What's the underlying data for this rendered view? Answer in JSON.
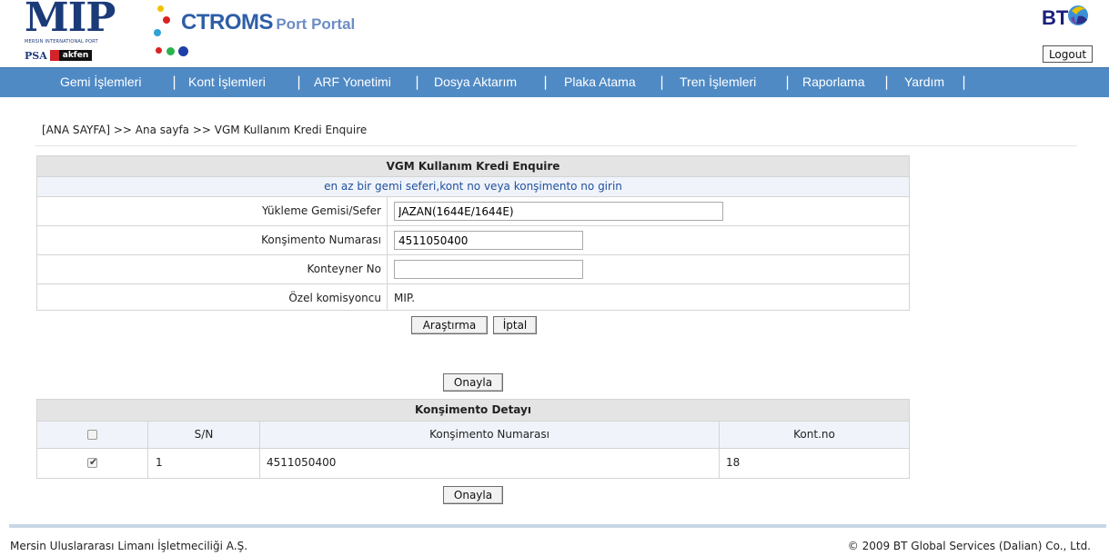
{
  "header": {
    "mip_logo": "MIP",
    "mip_subtitle": "MERSIN INTERNATIONAL PORT",
    "psa_text": "PSA",
    "akfen_text": "akfen",
    "portal_title_big": "CTROMS",
    "portal_title_small": "Port Portal",
    "bt_logo": "BT",
    "logout_label": "Logout",
    "colors": {
      "nav_bar": "#4f8ac5",
      "brand_blue": "#2f5ea8"
    }
  },
  "nav": {
    "items": [
      "Gemi İşlemleri",
      "Kont İşlemleri",
      "ARF Yonetimi",
      "Dosya Aktarım",
      "Plaka Atama",
      "Tren İşlemleri",
      "Raporlama",
      "Yardım"
    ],
    "separator": "|"
  },
  "breadcrumb": "[ANA SAYFA] >> Ana sayfa >> VGM Kullanım Kredi Enquire",
  "form": {
    "title": "VGM Kullanım Kredi Enquire",
    "note": "en az bir gemi seferi,kont no veya konşimento no girin",
    "vessel_label": "Yükleme Gemisi/Sefer",
    "vessel_value": "JAZAN(1644E/1644E)",
    "bl_label": "Konşimento Numarası",
    "bl_value": "4511050400",
    "container_label": "Konteyner No",
    "container_value": "",
    "agent_label": "Özel komisyoncu",
    "agent_value": "MIP.",
    "search_label": "Araştırma",
    "cancel_label": "İptal",
    "confirm_label": "Onayla"
  },
  "detail": {
    "title": "Konşimento Detayı",
    "columns": [
      "S/N",
      "Konşimento Numarası",
      "Kont.no"
    ],
    "rows": [
      {
        "checked": true,
        "sn": "1",
        "bl_no": "4511050400",
        "cont_no": "18"
      }
    ],
    "confirm_label": "Onayla"
  },
  "footer": {
    "left": "Mersin Uluslararası Limanı İşletmeciliği A.Ş.",
    "right": "© 2009 BT Global Services (Dalian) Co., Ltd."
  }
}
